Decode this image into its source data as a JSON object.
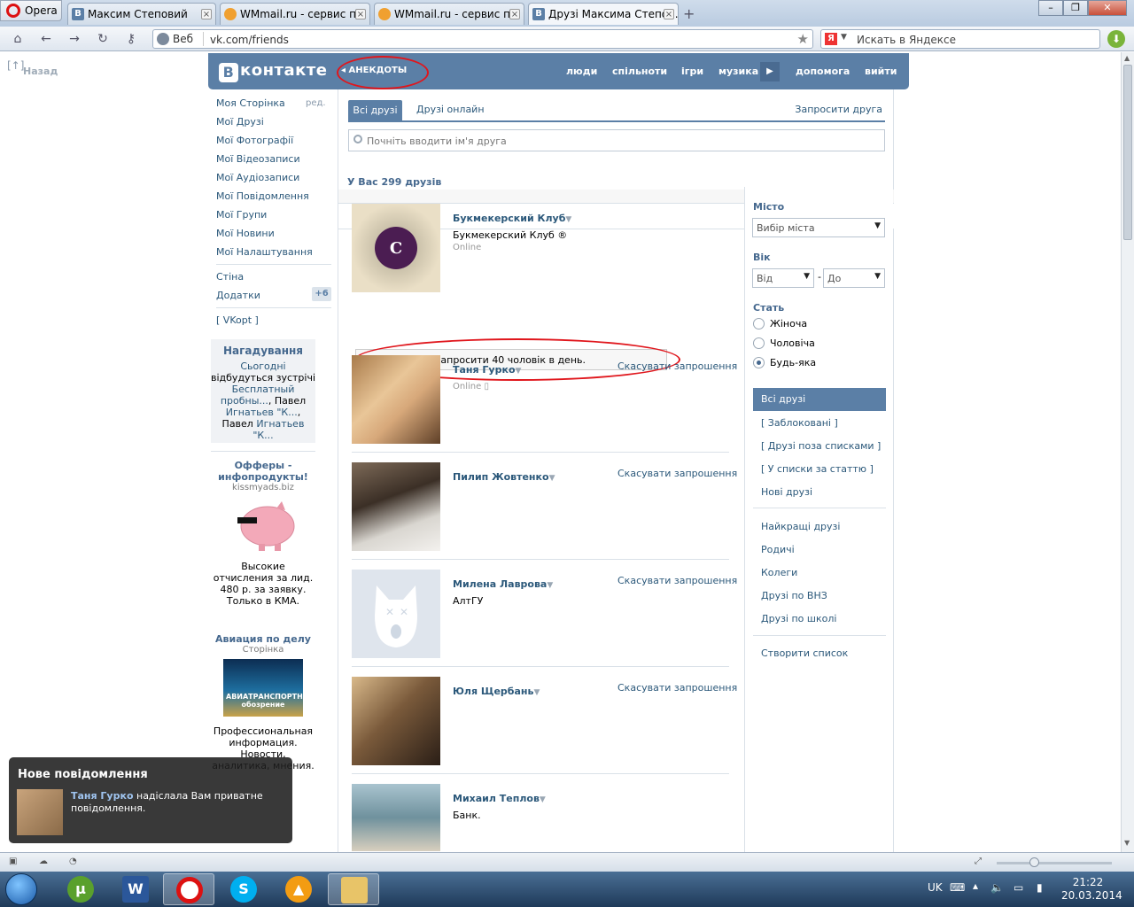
{
  "browser": {
    "menu_label": "Opera",
    "tabs": [
      {
        "label": "Максим Степовий",
        "icon": "vk-favicon"
      },
      {
        "label": "WMmail.ru - сервис п...",
        "icon": "wmmail-favicon"
      },
      {
        "label": "WMmail.ru - сервис п...",
        "icon": "wmmail-favicon"
      },
      {
        "label": "Друзі Максима Степо...",
        "icon": "vk-favicon"
      }
    ],
    "address_prefix": "Веб",
    "url": "vk.com/friends",
    "search_placeholder": "Искать в Яндексе"
  },
  "page": {
    "back_label": "Назад",
    "back_icon_text": "[↑]",
    "header": {
      "logo_b": "В",
      "logo_text": "контакте",
      "back_section": "АНЕКДОТЫ",
      "nav": [
        "люди",
        "спільноти",
        "ігри",
        "музика",
        "допомога",
        "вийти"
      ]
    },
    "left_menu": {
      "items": [
        "Моя Сторінка",
        "Мої Друзі",
        "Мої Фотографії",
        "Мої Відеозаписи",
        "Мої Аудіозаписи",
        "Мої Повідомлення",
        "Мої Групи",
        "Мої Новини",
        "Мої Налаштування"
      ],
      "edit": "ред.",
      "wall": "Стіна",
      "apps": "Додатки",
      "apps_badge": "+6",
      "vkopt": "[ VKopt ]"
    },
    "reminders": {
      "title": "Нагадування",
      "today": "Сьогодні",
      "text": "відбудуться зустрічі",
      "link1": "Бесплатный пробны...",
      "sep": ", Павел",
      "link2": "Игнатьев \"К...",
      "sep2": ", Павел",
      "link3": "Игнатьев \"К..."
    },
    "ads": [
      {
        "title": "Офферы - инфопродукты!",
        "domain": "kissmyads.biz",
        "body": "Высокие отчисления за лид. 480 р. за заявку. Только в КМА."
      },
      {
        "title": "Авиация по делу",
        "domain": "Сторінка",
        "body": "Профессиональная информация. Новости, аналитика, мнения.",
        "image_text": "АВИАТРАНСПОРТНОЕ обозрение"
      }
    ],
    "friends": {
      "tab_all": "Всі друзі",
      "tab_online": "Друзі онлайн",
      "invite": "Запросити друга",
      "search_placeholder": "Почніть вводити ім'я друга",
      "count_text": "У Вас 299 друзів",
      "notice": "Ви можете запросити 40 чоловік в день.",
      "items": [
        {
          "name": "Букмекерский Клуб",
          "sub": "Букмекерский Клуб ®",
          "online": "Online",
          "cancel": ""
        },
        {
          "name": "Таня Гурко",
          "sub": "",
          "online": "Online",
          "cancel": "Скасувати запрошення"
        },
        {
          "name": "Пилип Жовтенко",
          "sub": "",
          "online": "",
          "cancel": "Скасувати запрошення"
        },
        {
          "name": "Милена Лаврова",
          "sub": "АлтГУ",
          "online": "",
          "cancel": "Скасувати запрошення"
        },
        {
          "name": "Юля Щербань",
          "sub": "",
          "online": "",
          "cancel": "Скасувати запрошення"
        },
        {
          "name": "Михаил Теплов",
          "sub": "Банк.",
          "online": "",
          "cancel": ""
        }
      ]
    },
    "filters": {
      "city_label": "Місто",
      "city_value": "Вибір міста",
      "age_label": "Вік",
      "age_from": "Від",
      "age_dash": "-",
      "age_to": "До",
      "gender_label": "Стать",
      "genders": [
        "Жіноча",
        "Чоловіча",
        "Будь-яка"
      ],
      "gender_selected": 2,
      "lists_active": "Всі друзі",
      "lists": [
        "[ Заблоковані ]",
        "[ Друзі поза списками ]",
        "[ У списки за статтю ]",
        "Нові друзі"
      ],
      "lists2": [
        "Найкращі друзі",
        "Родичі",
        "Колеги",
        "Друзі по ВНЗ",
        "Друзі по школі"
      ],
      "create_list": "Створити список"
    },
    "popup": {
      "title": "Нове повідомлення",
      "sender": "Таня Гурко",
      "text": " надіслала Вам приватне повідомлення."
    }
  },
  "taskbar": {
    "apps": [
      "utorrent-icon",
      "word-icon",
      "opera-icon",
      "skype-icon",
      "aimp-icon",
      "explorer-icon"
    ],
    "lang": "UK",
    "time": "21:22",
    "date": "20.03.2014"
  },
  "colors": {
    "vk_blue": "#5b7fa6",
    "vk_link": "#2b587a",
    "annotation_red": "#e0161c"
  }
}
